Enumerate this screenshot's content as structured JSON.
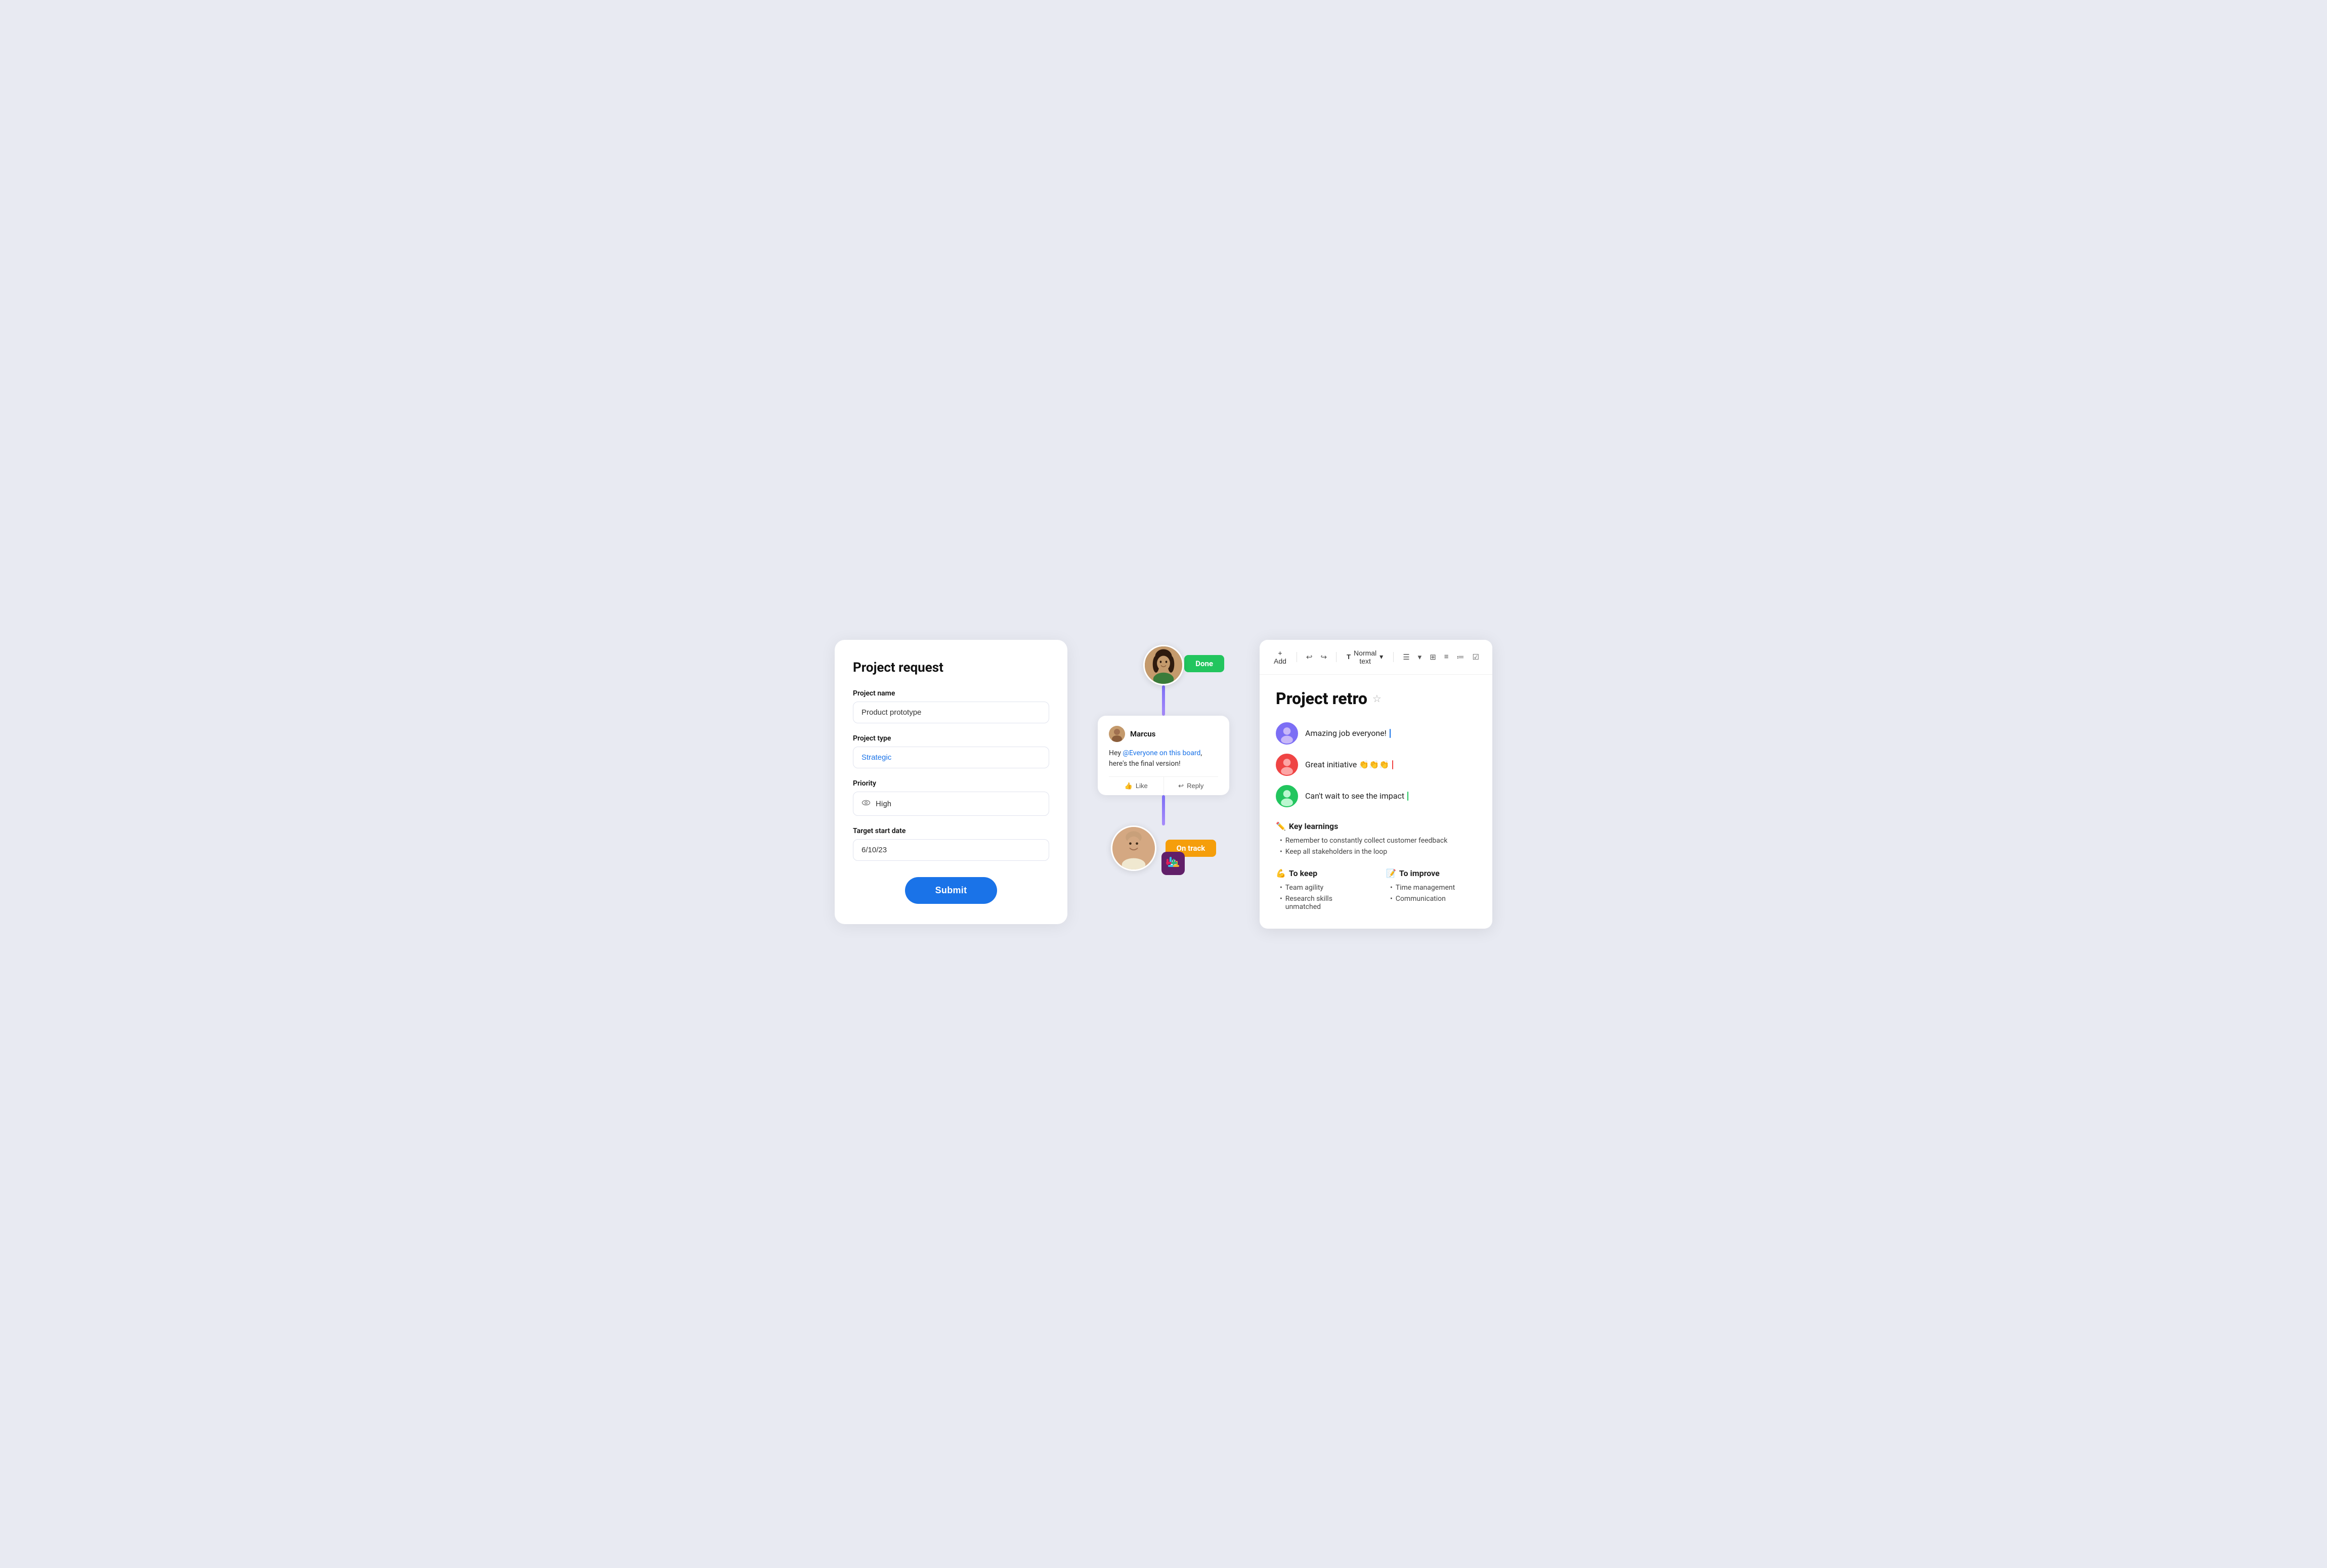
{
  "form": {
    "title": "Project request",
    "fields": {
      "project_name": {
        "label": "Project name",
        "value": "Product prototype"
      },
      "project_type": {
        "label": "Project type",
        "value": "Strategic"
      },
      "priority": {
        "label": "Priority",
        "value": "High"
      },
      "target_start_date": {
        "label": "Target start date",
        "value": "6/10/23"
      }
    },
    "submit_label": "Submit"
  },
  "flow": {
    "done_badge": "Done",
    "on_track_badge": "On track",
    "comment": {
      "user": "Marcus",
      "text_before": "Hey ",
      "mention": "@Everyone on this board",
      "text_after": ", here's the final version!",
      "like_label": "Like",
      "reply_label": "Reply"
    }
  },
  "retro": {
    "toolbar": {
      "add_label": "+ Add",
      "text_format": "Normal text",
      "chevron": "▾"
    },
    "title": "Project retro",
    "star": "☆",
    "comments": [
      {
        "text": "Amazing job everyone!",
        "cursor": "blue"
      },
      {
        "text": "Great initiative 👏👏👏",
        "cursor": "red"
      },
      {
        "text": "Can't wait to see the impact",
        "cursor": "green"
      }
    ],
    "key_learnings": {
      "title": "Key learnings",
      "emoji": "✏️",
      "items": [
        "Remember to constantly collect customer feedback",
        "Keep all stakeholders in the loop"
      ]
    },
    "to_keep": {
      "title": "To keep",
      "emoji": "💪",
      "items": [
        "Team agility",
        "Research skills unmatched"
      ]
    },
    "to_improve": {
      "title": "To improve",
      "emoji": "📝",
      "items": [
        "Time management",
        "Communication"
      ]
    }
  }
}
